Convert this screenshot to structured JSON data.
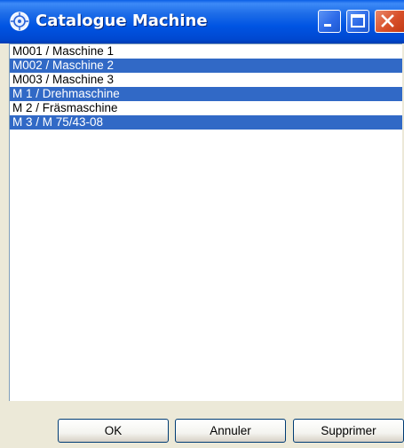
{
  "window": {
    "title": "Catalogue Machine",
    "icon": "catalog-app-icon",
    "controls": [
      "minimize-icon",
      "maximize-icon",
      "close-icon"
    ]
  },
  "list": {
    "items": [
      {
        "label": "M001 / Maschine 1",
        "selected": false
      },
      {
        "label": "M002 / Maschine 2",
        "selected": true
      },
      {
        "label": "M003 / Maschine 3",
        "selected": false
      },
      {
        "label": "M 1 / Drehmaschine",
        "selected": true
      },
      {
        "label": "M 2 / Fräsmaschine",
        "selected": false
      },
      {
        "label": "M 3 / M 75/43-08",
        "selected": true
      }
    ]
  },
  "buttons": {
    "ok": "OK",
    "cancel": "Annuler",
    "delete": "Supprimer"
  },
  "colors": {
    "titlebar": "#0054e3",
    "selection": "#3169c6",
    "face": "#ece9d8"
  }
}
